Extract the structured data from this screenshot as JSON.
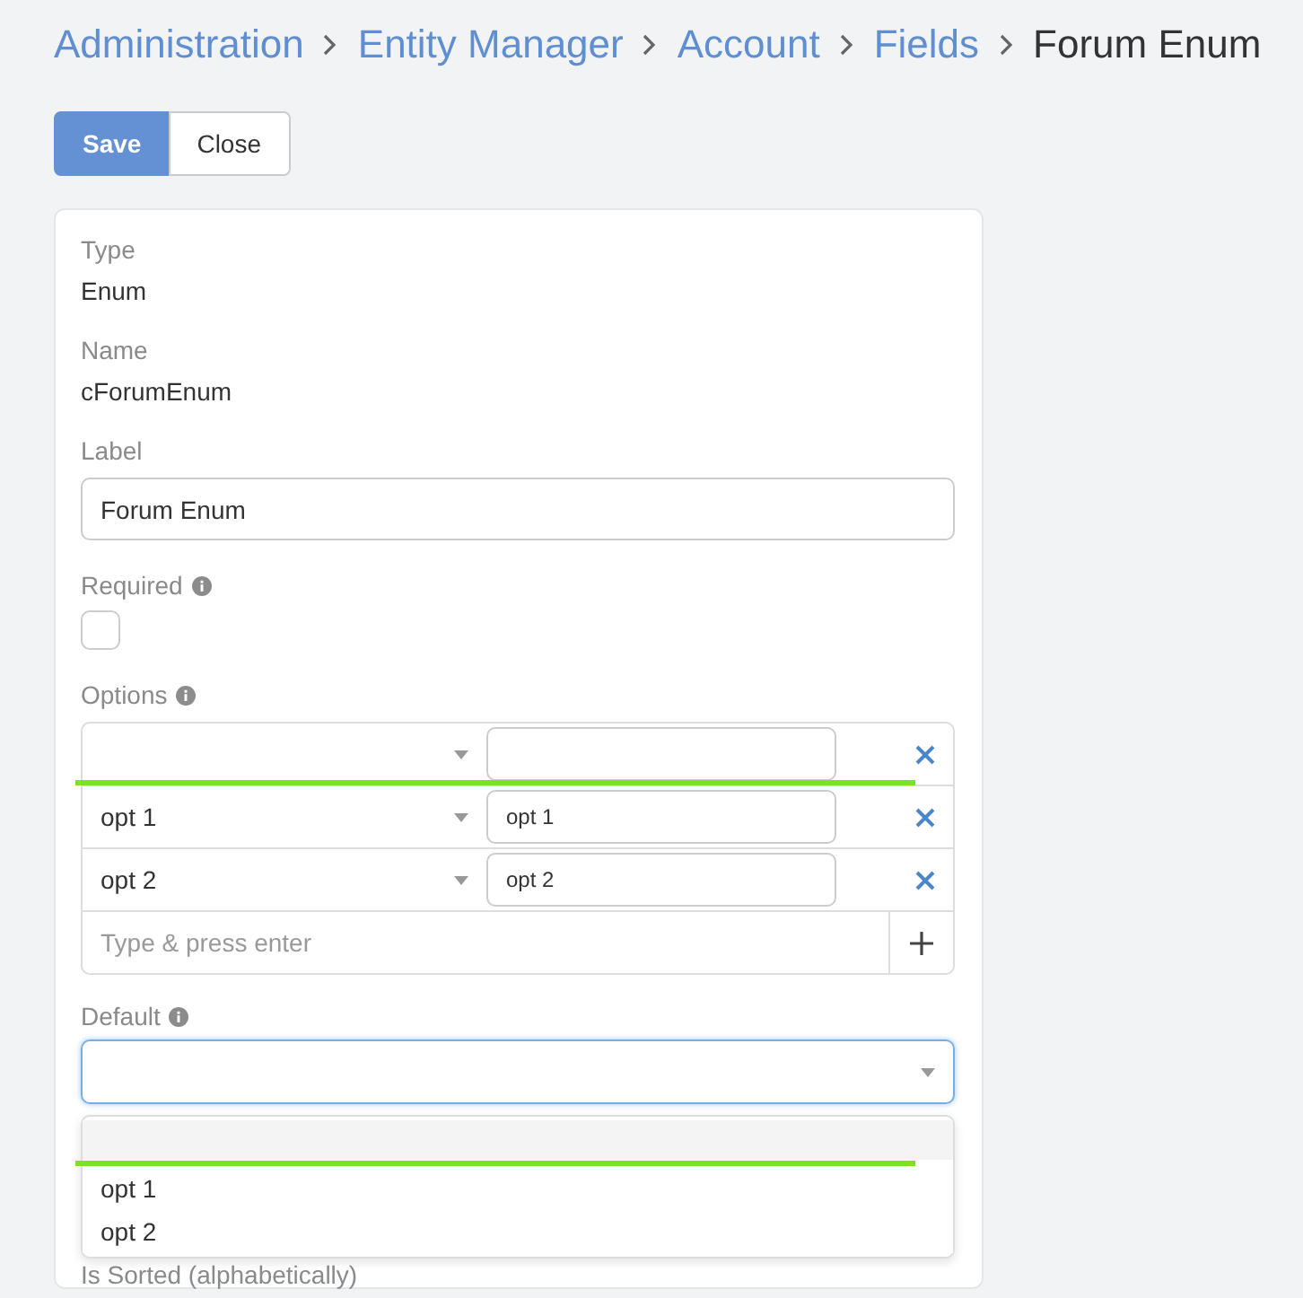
{
  "breadcrumb": [
    {
      "label": "Administration",
      "kind": "link"
    },
    {
      "label": "Entity Manager",
      "kind": "link"
    },
    {
      "label": "Account",
      "kind": "link"
    },
    {
      "label": "Fields",
      "kind": "link"
    },
    {
      "label": "Forum Enum",
      "kind": "current"
    }
  ],
  "buttons": [
    {
      "label": "Save",
      "kind": "primary"
    },
    {
      "label": "Close",
      "kind": "default"
    }
  ],
  "form": {
    "type": {
      "label": "Type",
      "value": "Enum"
    },
    "name": {
      "label": "Name",
      "value": "cForumEnum"
    },
    "label_field": {
      "label": "Label",
      "value": "Forum Enum"
    },
    "required": {
      "label": "Required",
      "checked": false
    },
    "options": {
      "label": "Options",
      "placeholder": "Type & press enter",
      "items": [
        {
          "highlighted": true
        },
        {
          "value": "opt 1",
          "translation": "opt 1",
          "highlighted": false
        },
        {
          "value": "opt 2",
          "translation": "opt 2",
          "highlighted": false
        }
      ]
    },
    "default": {
      "label": "Default",
      "open": true,
      "items": [
        {
          "selected": true
        },
        {
          "label": "opt 1",
          "selected": false
        },
        {
          "label": "opt 2",
          "selected": false
        }
      ]
    },
    "is_sorted": {
      "label": "Is Sorted (alphabetically)"
    }
  }
}
